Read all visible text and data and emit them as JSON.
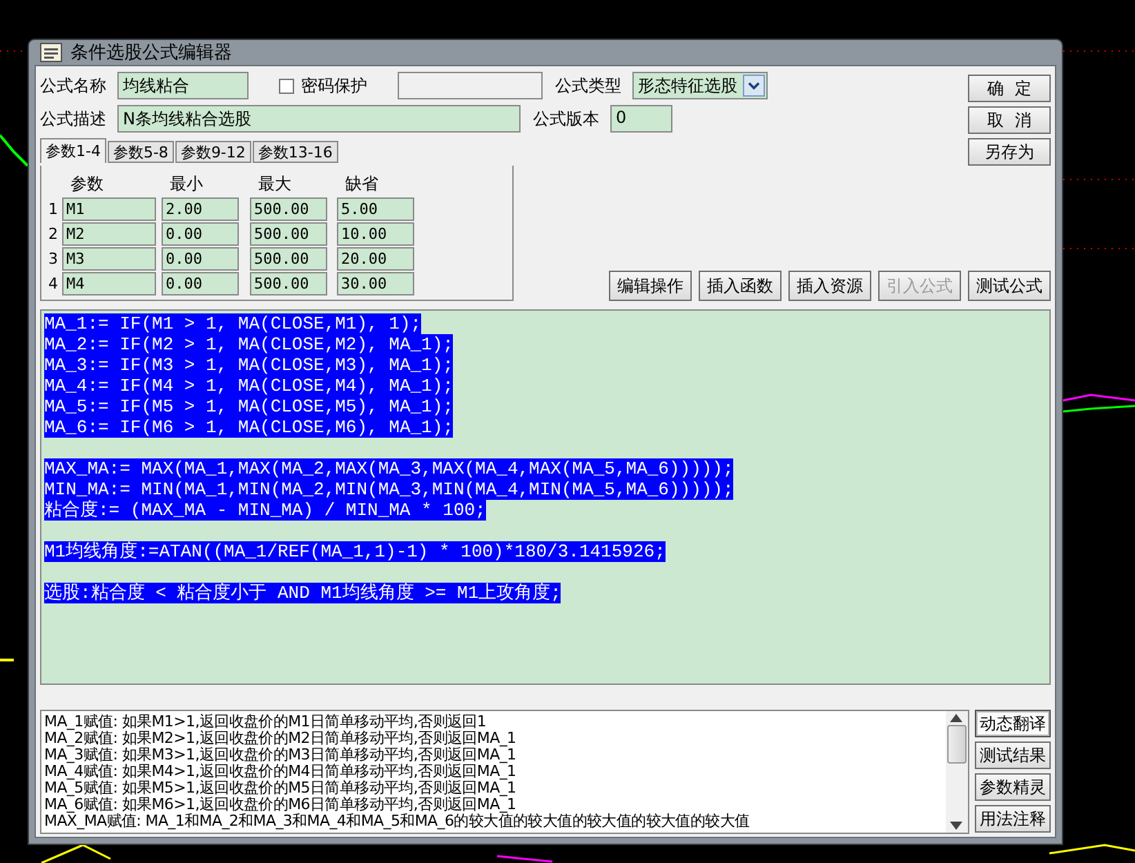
{
  "window": {
    "title": "条件选股公式编辑器"
  },
  "form": {
    "name_label": "公式名称",
    "name": "均线粘合",
    "password": {
      "label": "密码保护",
      "checked": false
    },
    "type_label": "公式类型",
    "type": "形态特征选股",
    "desc_label": "公式描述",
    "desc": "N条均线粘合选股",
    "version_label": "公式版本",
    "version": "0"
  },
  "side_buttons": [
    "确  定",
    "取  消",
    "另存为"
  ],
  "tabs": [
    {
      "label": "参数1-4",
      "selected": true
    },
    {
      "label": "参数5-8",
      "selected": false
    },
    {
      "label": "参数9-12",
      "selected": false
    },
    {
      "label": "参数13-16",
      "selected": false
    }
  ],
  "params": {
    "columns": [
      "参数",
      "最小",
      "最大",
      "缺省"
    ],
    "rows": [
      {
        "index": "1",
        "cells": [
          "M1",
          "2.00",
          "500.00",
          "5.00"
        ]
      },
      {
        "index": "2",
        "cells": [
          "M2",
          "0.00",
          "500.00",
          "10.00"
        ]
      },
      {
        "index": "3",
        "cells": [
          "M3",
          "0.00",
          "500.00",
          "20.00"
        ]
      },
      {
        "index": "4",
        "cells": [
          "M4",
          "0.00",
          "500.00",
          "30.00"
        ]
      }
    ]
  },
  "actions": [
    {
      "label": "编辑操作",
      "disabled": false
    },
    {
      "label": "插入函数",
      "disabled": false
    },
    {
      "label": "插入资源",
      "disabled": false
    },
    {
      "label": "引入公式",
      "disabled": true
    },
    {
      "label": "测试公式",
      "disabled": false
    }
  ],
  "editor": {
    "selected": true,
    "blocks": [
      [
        "MA_1:= IF(M1 > 1, MA(CLOSE,M1), 1);",
        "MA_2:= IF(M2 > 1, MA(CLOSE,M2), MA_1);",
        "MA_3:= IF(M3 > 1, MA(CLOSE,M3), MA_1);",
        "MA_4:= IF(M4 > 1, MA(CLOSE,M4), MA_1);",
        "MA_5:= IF(M5 > 1, MA(CLOSE,M5), MA_1);",
        "MA_6:= IF(M6 > 1, MA(CLOSE,M6), MA_1);"
      ],
      [
        "MAX_MA:= MAX(MA_1,MAX(MA_2,MAX(MA_3,MAX(MA_4,MAX(MA_5,MA_6)))));",
        "MIN_MA:= MIN(MA_1,MIN(MA_2,MIN(MA_3,MIN(MA_4,MIN(MA_5,MA_6)))));",
        "粘合度:= (MAX_MA - MIN_MA) / MIN_MA * 100;"
      ],
      [
        "M1均线角度:=ATAN((MA_1/REF(MA_1,1)-1) * 100)*180/3.1415926;"
      ],
      [
        "选股:粘合度 < 粘合度小于 AND M1均线角度 >= M1上攻角度;"
      ]
    ]
  },
  "help": {
    "lines": [
      "MA_1赋值: 如果M1>1,返回收盘价的M1日简单移动平均,否则返回1",
      "MA_2赋值: 如果M2>1,返回收盘价的M2日简单移动平均,否则返回MA_1",
      "MA_3赋值: 如果M3>1,返回收盘价的M3日简单移动平均,否则返回MA_1",
      "MA_4赋值: 如果M4>1,返回收盘价的M4日简单移动平均,否则返回MA_1",
      "MA_5赋值: 如果M5>1,返回收盘价的M5日简单移动平均,否则返回MA_1",
      "MA_6赋值: 如果M6>1,返回收盘价的M6日简单移动平均,否则返回MA_1",
      "MAX_MA赋值: MA_1和MA_2和MA_3和MA_4和MA_5和MA_6的较大值的较大值的较大值的较大值的较大值"
    ]
  },
  "help_buttons": [
    {
      "label": "动态翻译",
      "pressed": true
    },
    {
      "label": "测试结果",
      "pressed": false
    },
    {
      "label": "参数精灵",
      "pressed": false
    },
    {
      "label": "用法注释",
      "pressed": false
    }
  ]
}
